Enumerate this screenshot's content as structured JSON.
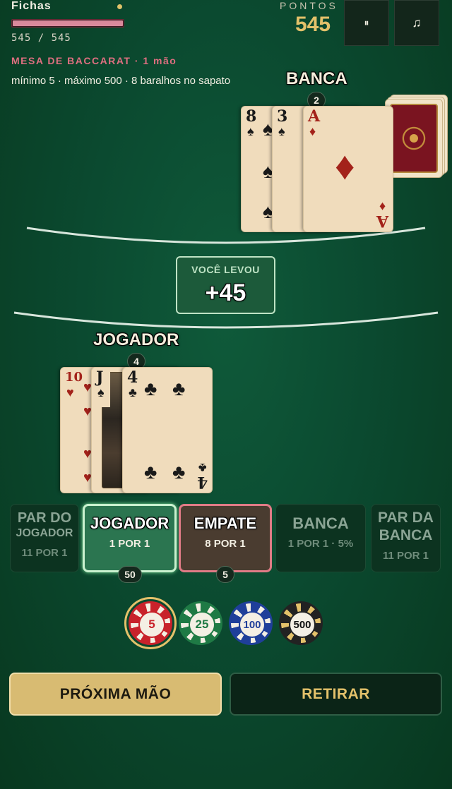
{
  "header": {
    "chips_label": "Fichas",
    "chips_current": 545,
    "chips_max": 545,
    "chips_text": "545 / 545",
    "points_label": "PONTOS",
    "points_value": "545",
    "pause_icon": "pause-icon",
    "music_icon": "music-icon",
    "pause_glyph": "⏸",
    "music_glyph": "♫"
  },
  "table": {
    "title": "MESA DE BACCARAT · 1 mão",
    "limits": "mínimo 5 · máximo 500 · 8 baralhos no sapato"
  },
  "banker": {
    "title": "BANCA",
    "score": "2",
    "cards": [
      {
        "rank": "8",
        "suit": "♠",
        "color": "black"
      },
      {
        "rank": "3",
        "suit": "♠",
        "color": "black"
      },
      {
        "rank": "A",
        "suit": "♦",
        "color": "red"
      }
    ]
  },
  "result": {
    "label": "VOCÊ LEVOU",
    "value": "+45"
  },
  "player": {
    "title": "JOGADOR",
    "score": "4",
    "cards": [
      {
        "rank": "10",
        "suit": "♥",
        "color": "red"
      },
      {
        "rank": "J",
        "suit": "♠",
        "color": "black"
      },
      {
        "rank": "4",
        "suit": "♣",
        "color": "black"
      }
    ]
  },
  "bets": [
    {
      "id": "player-pair",
      "label": "PAR DO JOGADOR",
      "line1": "PAR DO",
      "line2": "JOGADOR",
      "odds": "11 POR 1",
      "active": false
    },
    {
      "id": "player",
      "label": "JOGADOR",
      "odds": "1 POR 1",
      "active": true,
      "stake": "50"
    },
    {
      "id": "tie",
      "label": "EMPATE",
      "odds": "8 POR 1",
      "active": true,
      "stake": "5"
    },
    {
      "id": "banker",
      "label": "BANCA",
      "odds": "1 POR 1 · 5%",
      "active": false
    },
    {
      "id": "banker-pair",
      "label": "PAR DA BANCA",
      "line1": "PAR DA",
      "line2": "BANCA",
      "odds": "11 POR 1",
      "active": false
    }
  ],
  "chips": [
    {
      "value": "5",
      "color": "#c8222b",
      "selected": true
    },
    {
      "value": "25",
      "color": "#1f7a45",
      "selected": false
    },
    {
      "value": "100",
      "color": "#1f3f9a",
      "selected": false
    },
    {
      "value": "500",
      "color": "#222222",
      "selected": false
    }
  ],
  "actions": {
    "next_hand": "PRÓXIMA MÃO",
    "withdraw": "RETIRAR"
  },
  "colors": {
    "felt": "#0b4a30",
    "gold": "#e3c16a",
    "accent_pink": "#de6f80"
  }
}
